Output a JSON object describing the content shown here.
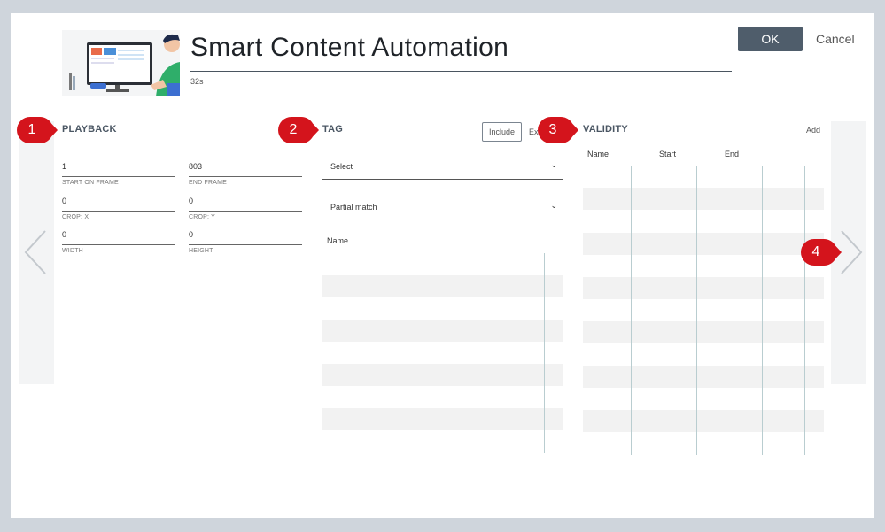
{
  "header": {
    "title": "Smart Content Automation",
    "duration": "32s",
    "ok_label": "OK",
    "cancel_label": "Cancel"
  },
  "playback": {
    "title": "PLAYBACK",
    "fields": [
      {
        "value": "1",
        "label": "START ON FRAME"
      },
      {
        "value": "803",
        "label": "END FRAME"
      },
      {
        "value": "0",
        "label": "CROP: X"
      },
      {
        "value": "0",
        "label": "CROP: Y"
      },
      {
        "value": "0",
        "label": "WIDTH"
      },
      {
        "value": "0",
        "label": "HEIGHT"
      }
    ]
  },
  "tag": {
    "title": "TAG",
    "include_label": "Include",
    "exclude_label": "Ex",
    "select_value": "Select",
    "match_value": "Partial match",
    "column_name": "Name"
  },
  "validity": {
    "title": "VALIDITY",
    "add_label": "Add",
    "columns": [
      "Name",
      "Start",
      "End"
    ]
  },
  "badges": [
    "1",
    "2",
    "3",
    "4"
  ],
  "colors": {
    "badge": "#d4141c",
    "ok_button": "#4f5d6b",
    "backdrop": "#cfd5dc"
  }
}
